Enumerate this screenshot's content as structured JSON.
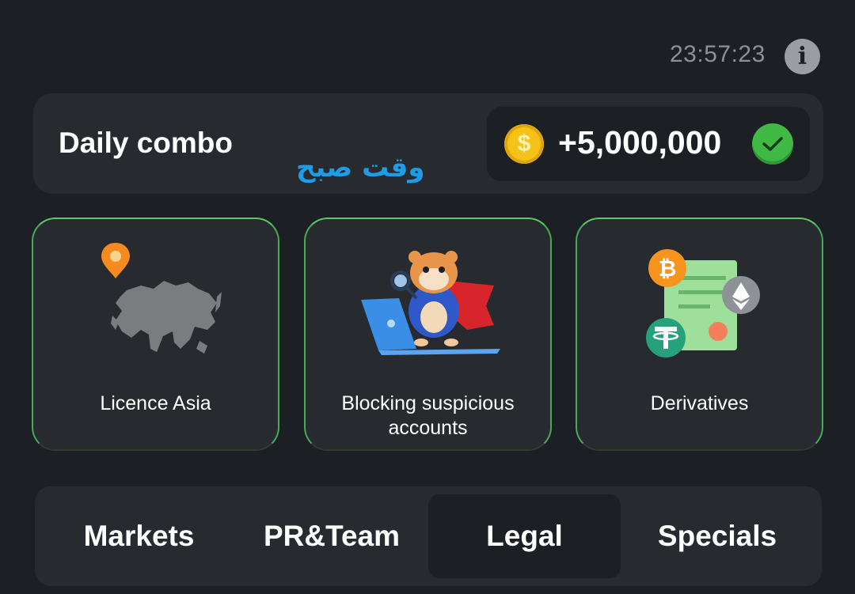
{
  "header": {
    "timer": "23:57:23",
    "info_icon": "info-icon",
    "info_glyph": "i"
  },
  "combo": {
    "title": "Daily combo",
    "note": "وقت صبح",
    "coin_glyph": "$",
    "reward": "+5,000,000",
    "status": "completed"
  },
  "cards": [
    {
      "label": "Licence Asia",
      "icon": "asia-map-icon"
    },
    {
      "label": "Blocking suspicious accounts",
      "icon": "hamster-laptop-icon"
    },
    {
      "label": "Derivatives",
      "icon": "crypto-document-icon"
    }
  ],
  "tabs": [
    {
      "label": "Markets",
      "active": false
    },
    {
      "label": "PR&Team",
      "active": false
    },
    {
      "label": "Legal",
      "active": true
    },
    {
      "label": "Specials",
      "active": false
    }
  ],
  "colors": {
    "background": "#1c1f24",
    "panel": "#272a2f",
    "accent_green": "#5cc768",
    "note_blue": "#1e9de6",
    "coin_gold": "#f5c318"
  }
}
